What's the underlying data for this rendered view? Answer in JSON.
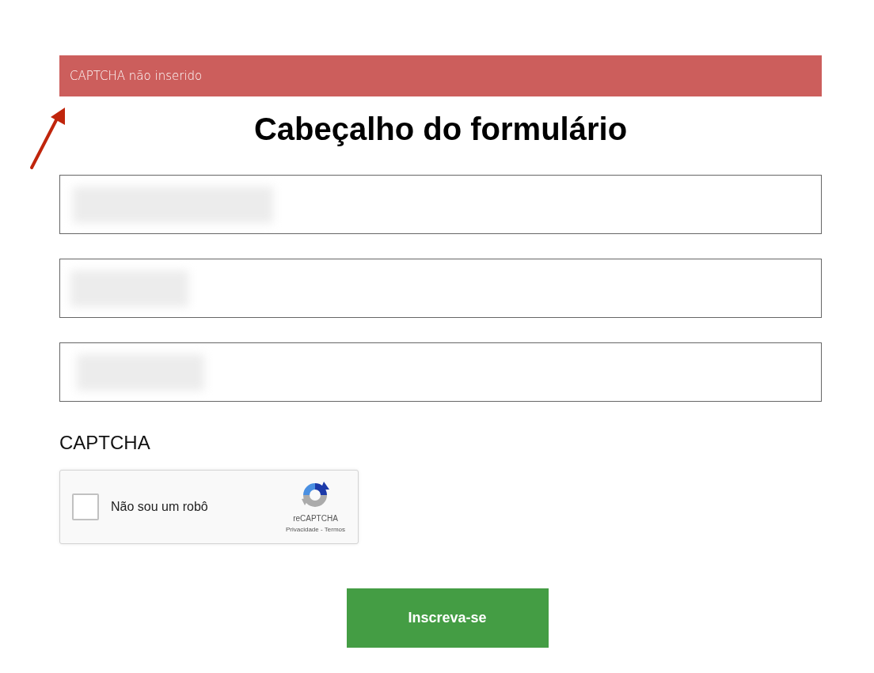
{
  "error_banner": {
    "text": "CAPTCHA não inserido"
  },
  "annotation_arrow": {
    "shown": true
  },
  "heading": "Cabeçalho do formulário",
  "fields": [
    {
      "redacted": true
    },
    {
      "redacted": true
    },
    {
      "redacted": true
    }
  ],
  "captcha_label": "CAPTCHA",
  "recaptcha": {
    "checked": false,
    "label": "Não sou um robô",
    "brand": "reCAPTCHA",
    "privacy_link": "Privacidade",
    "separator": "-",
    "terms_link": "Termos"
  },
  "submit_button": "Inscreva-se"
}
